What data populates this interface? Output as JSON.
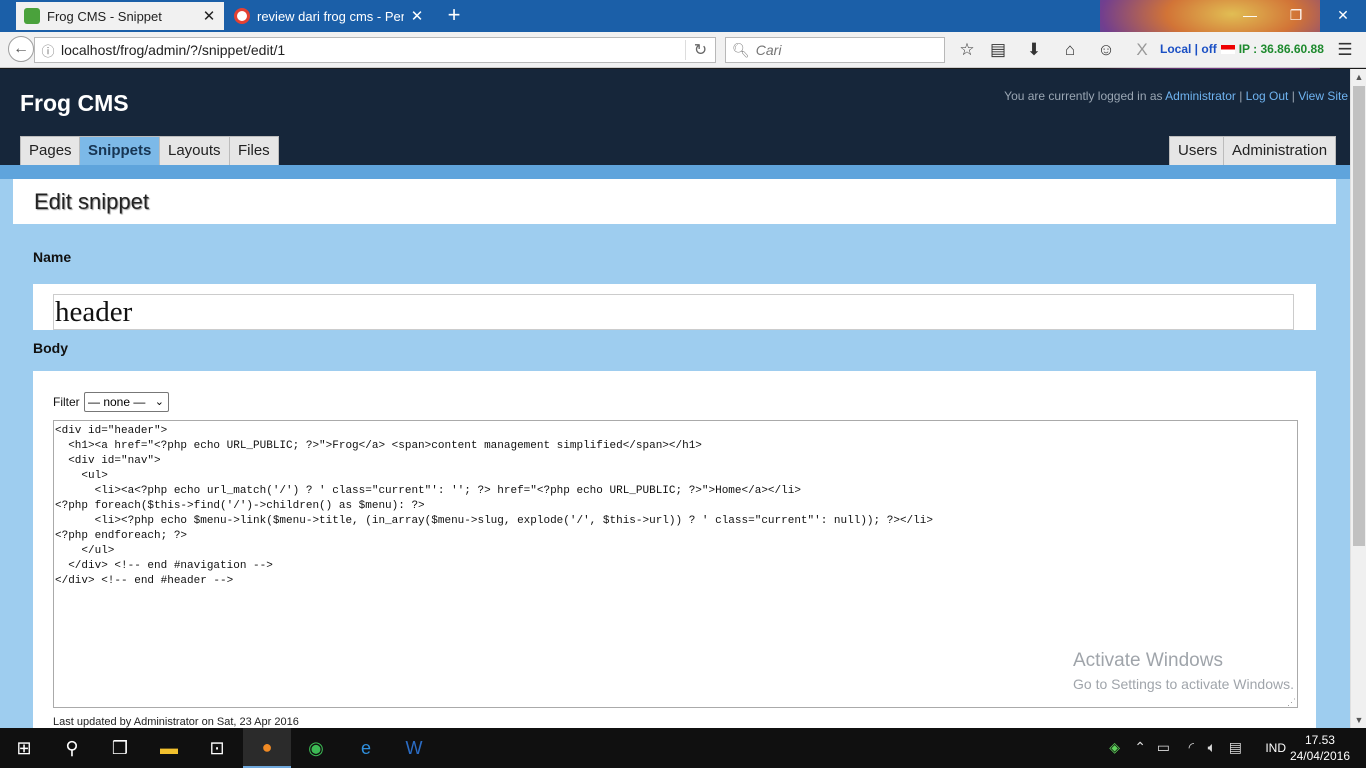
{
  "browser": {
    "tabs": [
      {
        "title": "Frog CMS - Snippet",
        "active": true
      },
      {
        "title": "review dari frog cms - Pen…",
        "active": false
      }
    ],
    "url": "localhost/frog/admin/?/snippet/edit/1",
    "search_placeholder": "Cari",
    "addon_status": {
      "local": "Local | off",
      "ip": "IP : 36.86.60.88"
    }
  },
  "site": {
    "logo": "Frog CMS",
    "login_text": "You are currently logged in as",
    "user": "Administrator",
    "separator": "|",
    "logout": "Log Out",
    "view_site": "View Site",
    "nav_left": [
      "Pages",
      "Snippets",
      "Layouts",
      "Files"
    ],
    "nav_right": [
      "Users",
      "Administration"
    ],
    "active_nav": "Snippets"
  },
  "editor": {
    "title": "Edit snippet",
    "name_label": "Name",
    "name_value": "header",
    "body_label": "Body",
    "filter_label": "Filter",
    "filter_value": "— none —",
    "code": "<div id=\"header\">\n  <h1><a href=\"<?php echo URL_PUBLIC; ?>\">Frog</a> <span>content management simplified</span></h1>\n  <div id=\"nav\">\n    <ul>\n      <li><a<?php echo url_match('/') ? ' class=\"current\"': ''; ?> href=\"<?php echo URL_PUBLIC; ?>\">Home</a></li>\n<?php foreach($this->find('/')->children() as $menu): ?>\n      <li><?php echo $menu->link($menu->title, (in_array($menu->slug, explode('/', $this->url)) ? ' class=\"current\"': null)); ?></li>\n<?php endforeach; ?>\n    </ul>\n  </div> <!-- end #navigation -->\n</div> <!-- end #header -->",
    "last_updated": "Last updated by Administrator on Sat, 23 Apr 2016"
  },
  "watermark": {
    "line1": "Activate Windows",
    "line2": "Go to Settings to activate Windows."
  },
  "taskbar": {
    "language": "IND",
    "time": "17.53",
    "date": "24/04/2016"
  }
}
